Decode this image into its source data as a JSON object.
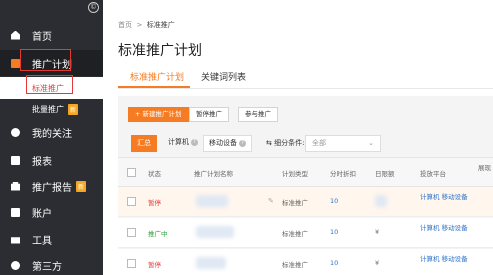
{
  "sidebar": {
    "items": [
      {
        "label": "首页",
        "icon": "home-icon"
      },
      {
        "label": "推广计划",
        "icon": "plan-icon"
      },
      {
        "label": "我的关注",
        "icon": "globe-icon"
      },
      {
        "label": "报表",
        "icon": "report-icon"
      },
      {
        "label": "推广报告",
        "icon": "report-icon",
        "badge": "新"
      },
      {
        "label": "账户",
        "icon": "account-icon"
      },
      {
        "label": "工具",
        "icon": "tool-icon"
      },
      {
        "label": "第三方",
        "icon": "third-party-icon"
      }
    ],
    "subitems": [
      {
        "label": "标准推广"
      },
      {
        "label": "批量推广",
        "badge": "新"
      }
    ]
  },
  "breadcrumb": {
    "home": "首页",
    "sep": ">",
    "current": "标准推广"
  },
  "page_title": "标准推广计划",
  "tabs": [
    "标准推广计划",
    "关键词列表"
  ],
  "toolbar": {
    "new_plan": "+ 新建推广计划",
    "pause": "暂停推广",
    "resume": "参与推广"
  },
  "filters": {
    "all": "汇总",
    "pc": "计算机",
    "mobile": "移动设备",
    "condition": "细分条件:",
    "select_value": "全部"
  },
  "table": {
    "headers": [
      "状态",
      "推广计划名称",
      "计划类型",
      "分时折扣",
      "日限额",
      "投放平台",
      "展现"
    ],
    "rows": [
      {
        "status": "暂停",
        "status_color": "#e23d3d",
        "type": "标准推广",
        "discount": "10",
        "budget": "¥",
        "platform": "计算机 移动设备",
        "selected": true
      },
      {
        "status": "推广中",
        "status_color": "#2e9e3a",
        "type": "标准推广",
        "discount": "10",
        "budget": "¥",
        "platform": "计算机 移动设备",
        "selected": false
      },
      {
        "status": "暂停",
        "status_color": "#e23d3d",
        "type": "标准推广",
        "discount": "10",
        "budget": "¥",
        "platform": "计算机 移动设备",
        "selected": false
      }
    ]
  },
  "colors": {
    "accent": "#f57c23",
    "sidebar_bg": "#2b2d32",
    "highlight_box": "#e53935"
  }
}
